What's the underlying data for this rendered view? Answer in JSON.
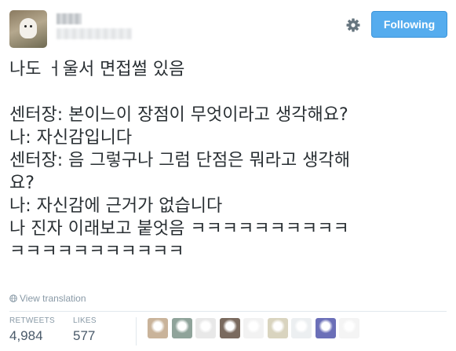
{
  "header": {
    "follow_label": "Following"
  },
  "tweet": {
    "lines": [
      "나도 ㅓ울서 면접썰 있음",
      "",
      "센터장: 본이느이 장점이 무엇이라고 생각해요?",
      "나: 자신감입니다",
      "센터장: 음 그렇구나 그럼 단점은 뭐라고 생각해",
      "요?",
      "나: 자신감에 근거가 없습니다",
      "나 진자 이래보고 붙엇음 ㅋㅋㅋㅋㅋㅋㅋㅋㅋㅋ",
      "ㅋㅋㅋㅋㅋㅋㅋㅋㅋㅋㅋ"
    ],
    "translate_label": "View translation"
  },
  "stats": {
    "retweets_label": "RETWEETS",
    "retweets_count": "4,984",
    "likes_label": "LIKES",
    "likes_count": "577"
  },
  "likers": [
    {
      "name": "liker-avatar",
      "color": "#c9b39a"
    },
    {
      "name": "liker-avatar",
      "color": "#8fa39a"
    },
    {
      "name": "liker-avatar",
      "color": "#e8e8e8"
    },
    {
      "name": "liker-avatar",
      "color": "#7a6a5e"
    },
    {
      "name": "liker-avatar",
      "color": "#f2f2f2"
    },
    {
      "name": "liker-avatar",
      "color": "#d9d4bf"
    },
    {
      "name": "liker-avatar",
      "color": "#eceff1"
    },
    {
      "name": "liker-avatar",
      "color": "#6b6fb8"
    },
    {
      "name": "liker-avatar",
      "color": "#f4f4f4"
    }
  ],
  "colors": {
    "accent": "#55acee",
    "text": "#292f33",
    "muted": "#8899a6"
  }
}
